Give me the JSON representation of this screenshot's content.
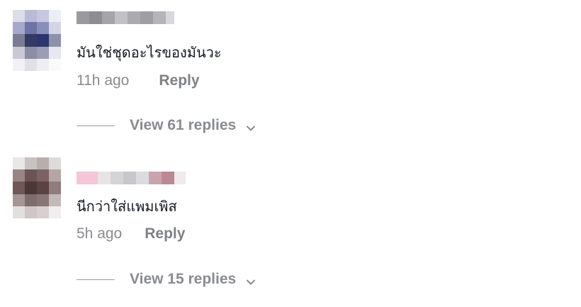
{
  "comments": [
    {
      "text": "มันใช่ชุดอะไรของมันวะ",
      "time": "11h ago",
      "reply_label": "Reply",
      "view_replies_label": "View 61 replies",
      "avatar_icon": "blurred-avatar",
      "avatar_colors": [
        "#dcdde8",
        "#b9bbd6",
        "#c6c8e0",
        "#eceef6",
        "#a6a8c9",
        "#6e73a6",
        "#8a8fba",
        "#d3d4e6",
        "#7a7c91",
        "#343a66",
        "#2d3570",
        "#8e91ab",
        "#c8c9d6",
        "#8c8ea6",
        "#9b9db5",
        "#e6e7ef",
        "#f2f2f6",
        "#dfe0e8",
        "#eeeef3",
        "#fafafc"
      ],
      "username_colors": [
        "#9a9a9e",
        "#8d8d92",
        "#a4a4a9",
        "#c2c2c6",
        "#ababaf",
        "#9e9ea3",
        "#b5b5b9",
        "#d8d8db"
      ]
    },
    {
      "text": "นีกว่าใส่แพมเพิส",
      "time": "5h ago",
      "reply_label": "Reply",
      "view_replies_label": "View 15 replies",
      "avatar_icon": "blurred-avatar",
      "avatar_colors": [
        "#e9e7e7",
        "#c9c2c2",
        "#b8aeae",
        "#dedada",
        "#9a8585",
        "#6b5454",
        "#7c6262",
        "#b5a6a6",
        "#6e5858",
        "#4a3838",
        "#5b4343",
        "#8f7c7c",
        "#a69595",
        "#7e6b6b",
        "#8a7575",
        "#c4b9b9",
        "#e4dfdf",
        "#d0c6c6",
        "#d8d0d0",
        "#efeded"
      ],
      "username_colors": [
        "#f4c6d7",
        "#e8e3e5",
        "#d4d4d6",
        "#c8c8ca",
        "#dcdcde",
        "#c9a4ac",
        "#b98994",
        "#f0eaec"
      ]
    }
  ],
  "icons": {
    "chevron": "chevron-down-icon"
  }
}
